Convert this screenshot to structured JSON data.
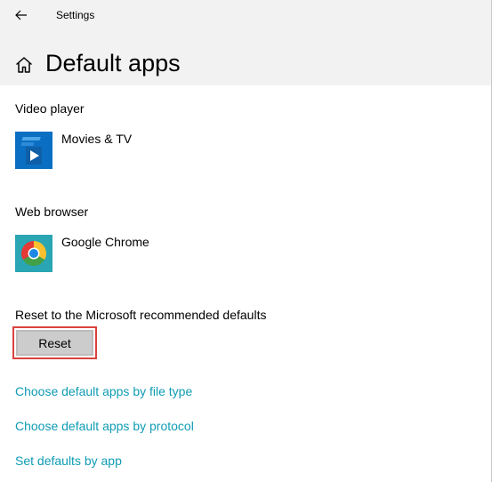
{
  "window": {
    "title": "Settings"
  },
  "header": {
    "page_title": "Default apps"
  },
  "video_player": {
    "label": "Video player",
    "app_name": "Movies & TV",
    "icon": "movies-tv-icon"
  },
  "web_browser": {
    "label": "Web browser",
    "app_name": "Google Chrome",
    "icon": "chrome-icon"
  },
  "reset": {
    "label": "Reset to the Microsoft recommended defaults",
    "button_label": "Reset"
  },
  "links": [
    {
      "label": "Choose default apps by file type"
    },
    {
      "label": "Choose default apps by protocol"
    },
    {
      "label": "Set defaults by app"
    }
  ],
  "colors": {
    "link": "#0f9cb4",
    "header_bg": "#f2f2f2",
    "highlight_outline": "#d9423e",
    "button_bg": "#cccccc",
    "movies_tv_tile": "#0a6fc2"
  }
}
